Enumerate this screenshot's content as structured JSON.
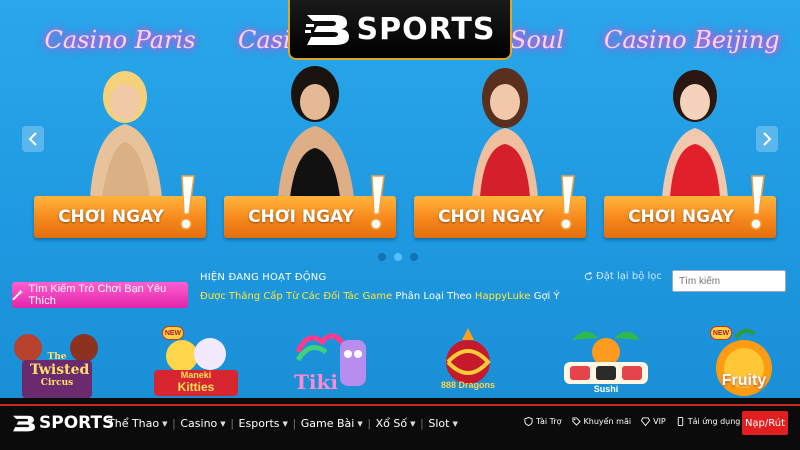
{
  "brand": {
    "name": "SPORTS"
  },
  "banner": {
    "cards": [
      {
        "title": "Casino Paris",
        "cta": "CHƠI NGAY"
      },
      {
        "title": "Casino",
        "cta": "CHƠI NGAY"
      },
      {
        "title": "Soul",
        "cta": "CHƠI NGAY"
      },
      {
        "title": "Casino Beijing",
        "cta": "CHƠI NGAY"
      }
    ],
    "slide_count": 3,
    "active_slide": 2
  },
  "filters": {
    "search_games_label": "Tìm Kiếm Trò Chơi Bạn Yêu Thích",
    "activity_title": "HIỆN ĐANG HOẠT ĐỘNG",
    "activity_line": {
      "p1": "Được Thăng Cấp Từ ",
      "p2": "Các Đối Tác Game",
      "p3": " Phân Loại Theo ",
      "p4": "HappyLuke",
      "p5": " Gợi Ý"
    },
    "reset_label": "Đặt lại bộ lọc",
    "search_placeholder": "Tìm kiếm"
  },
  "games": [
    {
      "label_line1": "The",
      "label_line2": "Twisted",
      "label_line3": "Circus",
      "new_badge": ""
    },
    {
      "label_line1": "Maneki",
      "label_line2": "Kitties",
      "label_line3": "",
      "new_badge": "NEW"
    },
    {
      "label_line1": "Tiki",
      "label_line2": "",
      "label_line3": "",
      "new_badge": ""
    },
    {
      "label_line1": "888",
      "label_line2": "Dragons",
      "label_line3": "",
      "new_badge": ""
    },
    {
      "label_line1": "Sushi",
      "label_line2": "",
      "label_line3": "",
      "new_badge": ""
    },
    {
      "label_line1": "Fruity",
      "label_line2": "",
      "label_line3": "",
      "new_badge": "NEW"
    }
  ],
  "bottom_nav": {
    "items": [
      "Thể Thao",
      "Casino",
      "Esports",
      "Game Bài",
      "Xổ Số",
      "Slot"
    ],
    "right_links": [
      "Tài Trợ",
      "Khuyến mãi",
      "VIP",
      "Tải ứng dụng"
    ],
    "deposit_label": "Nạp/Rút"
  },
  "colors": {
    "accent": "#e21f1f",
    "cta": "#f7871b",
    "pink": "#e224ac",
    "gold": "#d9a52b"
  }
}
